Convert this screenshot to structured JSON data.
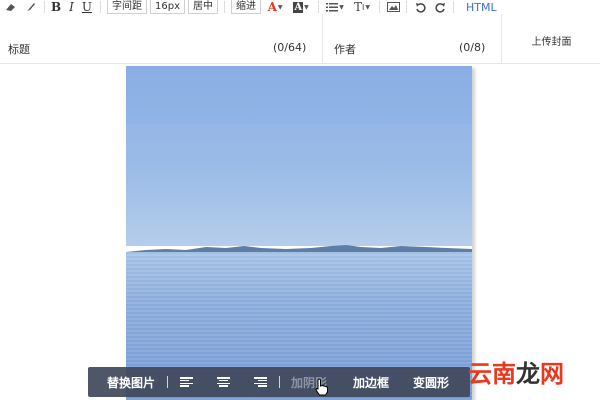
{
  "toolbar": {
    "letter_spacing_label": "字间距",
    "font_size_label": "16px",
    "center_label": "居中",
    "indent_label": "缩进",
    "html_label": "HTML",
    "font_color": "#e8391f",
    "icons": [
      "eraser-icon",
      "brush-icon",
      "bold-icon",
      "italic-icon",
      "underline-icon",
      "font-color-icon",
      "highlight-icon",
      "list-icon",
      "text-style-icon",
      "image-icon",
      "undo-icon",
      "redo-icon"
    ]
  },
  "fields": {
    "title_label": "标题",
    "title_count": "(0/64)",
    "author_label": "作者",
    "author_count": "(0/8)",
    "cover_label": "上传封面"
  },
  "image_toolbar": {
    "replace_label": "替换图片",
    "shadow_label": "加阴影",
    "border_label": "加边框",
    "round_label": "变圆形"
  },
  "watermark": {
    "part1": "云",
    "part2": "南",
    "part3": "龙",
    "part4": "网"
  }
}
